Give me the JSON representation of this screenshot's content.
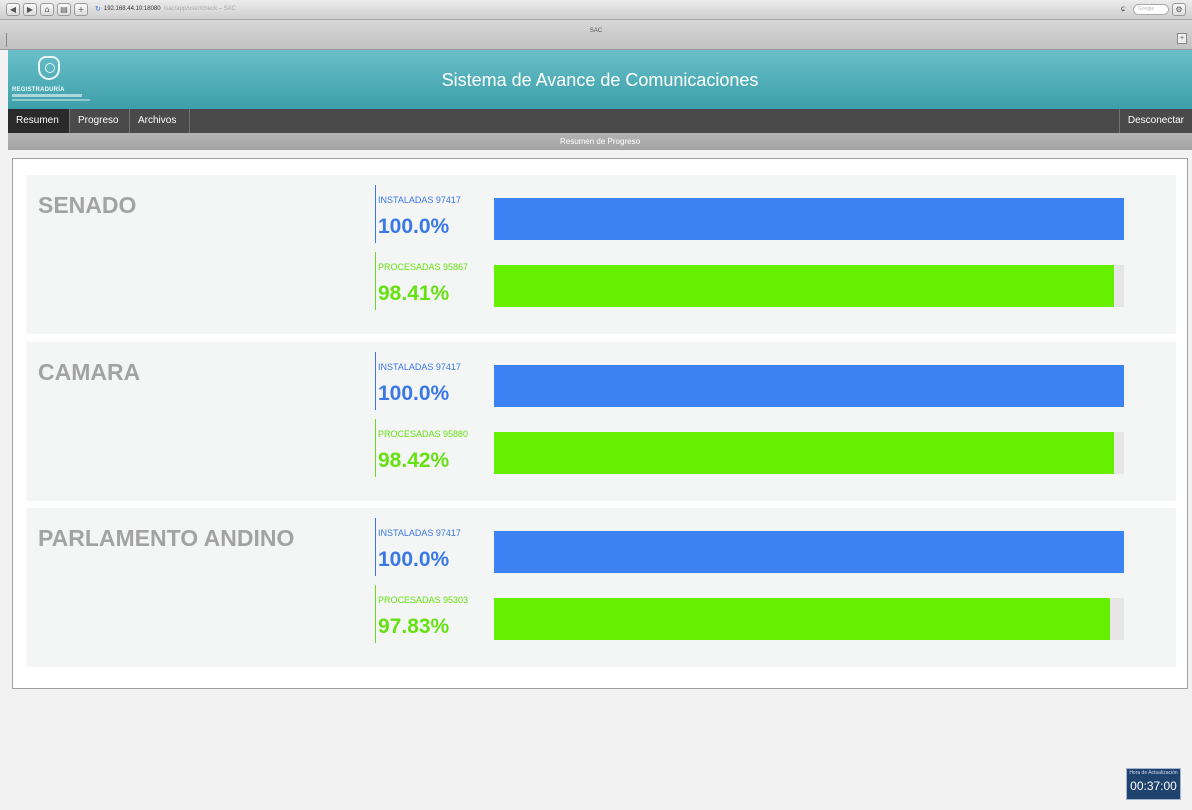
{
  "browser": {
    "nav_back": "◀",
    "nav_forward": "▶",
    "address_host": "192.168.44.10:18080",
    "address_rest": "/sac/app/user/check – SAC",
    "tab_title": "SAC",
    "search_placeholder": "Google",
    "plus": "+"
  },
  "header": {
    "logo_text": "REGISTRADURÍA",
    "title": "Sistema de Avance de Comunicaciones"
  },
  "nav": {
    "items": [
      "Resumen",
      "Progreso",
      "Archivos"
    ],
    "logout": "Desconectar"
  },
  "subheader": "Resumen de Progreso",
  "sections": [
    {
      "title": "SENADO",
      "metrics": [
        {
          "label": "INSTALADAS 97417",
          "percent_text": "100.0%",
          "fraction": 1.0
        },
        {
          "label": "PROCESADAS 95867",
          "percent_text": "98.41%",
          "fraction": 0.9841
        }
      ]
    },
    {
      "title": "CAMARA",
      "metrics": [
        {
          "label": "INSTALADAS 97417",
          "percent_text": "100.0%",
          "fraction": 1.0
        },
        {
          "label": "PROCESADAS 95880",
          "percent_text": "98.42%",
          "fraction": 0.9842
        }
      ]
    },
    {
      "title": "PARLAMENTO ANDINO",
      "metrics": [
        {
          "label": "INSTALADAS 97417",
          "percent_text": "100.0%",
          "fraction": 1.0
        },
        {
          "label": "PROCESADAS 95303",
          "percent_text": "97.83%",
          "fraction": 0.9783
        }
      ]
    }
  ],
  "timer": {
    "label": "Hora de Actualización",
    "value": "00:37:00"
  },
  "colors": {
    "installed": "#3d82f4",
    "processed": "#66ef00",
    "header_teal": "#4fb0ba"
  }
}
